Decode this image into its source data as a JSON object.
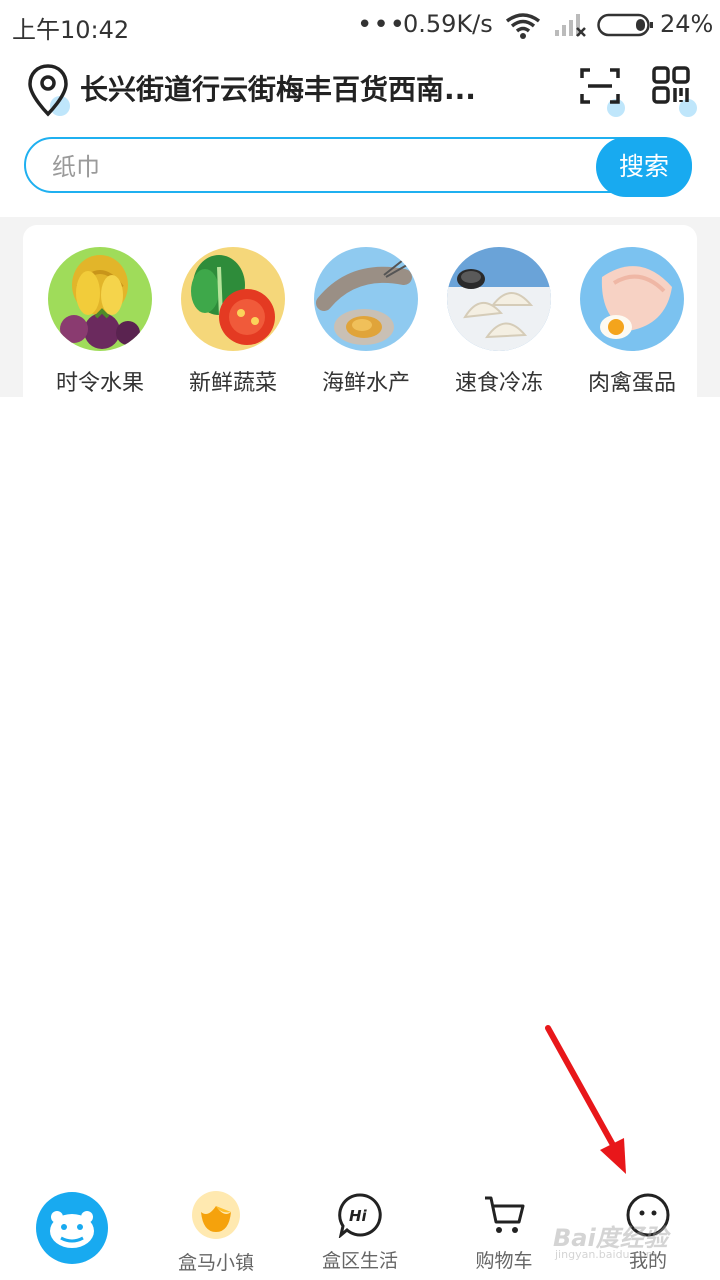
{
  "status_bar": {
    "time": "上午10:42",
    "dots": "•••",
    "speed": "0.59K/s",
    "battery": "24%",
    "icons": [
      "wifi-icon",
      "signal-icon",
      "battery-icon"
    ]
  },
  "header": {
    "address": "长兴街道行云街梅丰百货西南...",
    "icons": [
      "location-pin-icon",
      "scan-icon",
      "qr-code-icon"
    ]
  },
  "search": {
    "placeholder": "纸巾",
    "button_label": "搜索"
  },
  "categories": [
    {
      "label": "时令水果",
      "icon": "fruit-icon"
    },
    {
      "label": "新鲜蔬菜",
      "icon": "vegetable-icon"
    },
    {
      "label": "海鲜水产",
      "icon": "seafood-icon"
    },
    {
      "label": "速食冷冻",
      "icon": "frozen-dumpling-icon"
    },
    {
      "label": "肉禽蛋品",
      "icon": "meat-egg-icon"
    }
  ],
  "bottom_nav": [
    {
      "label": "",
      "icon": "hippo-home-icon",
      "active": true
    },
    {
      "label": "盒马小镇",
      "icon": "tulip-icon"
    },
    {
      "label": "盒区生活",
      "icon": "hi-chat-icon"
    },
    {
      "label": "购物车",
      "icon": "cart-icon"
    },
    {
      "label": "我的",
      "icon": "smiley-icon"
    }
  ],
  "watermark": {
    "text": "Bai度经验",
    "sub": "jingyan.baidu.com"
  },
  "colors": {
    "accent": "#18aaf0",
    "annotation": "#e8171a"
  }
}
